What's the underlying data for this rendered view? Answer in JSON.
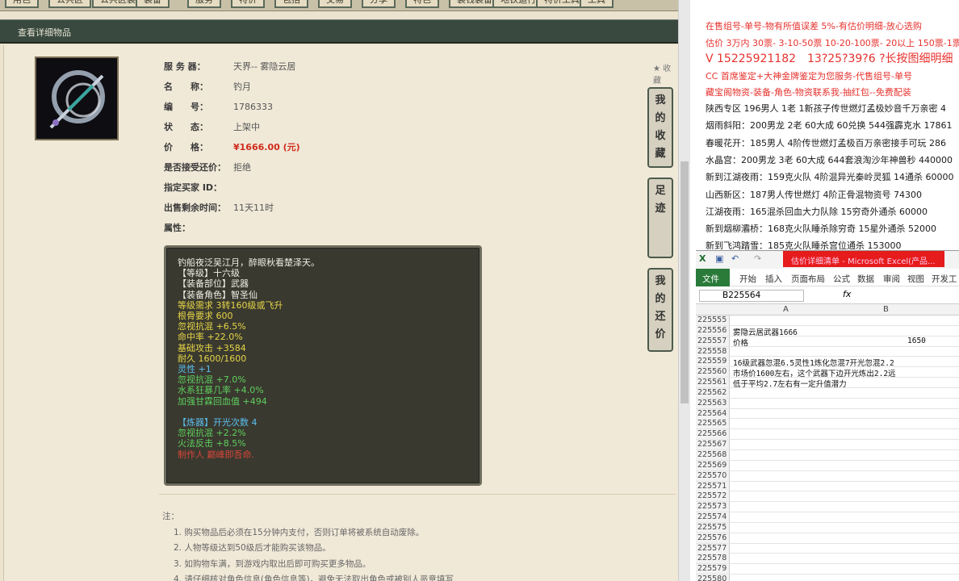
{
  "top_tabs": [
    "用色",
    "公共区",
    "公共区装备",
    "装备",
    "服务",
    "特价",
    "包括",
    "交易",
    "分享",
    "特色",
    "装钱装备",
    "地铁运行",
    "特价工具",
    "工具"
  ],
  "header": {
    "title": "查看详细物品"
  },
  "item": {
    "server_label": "服 务 器：",
    "server_value": "天界-- 雾隐云居",
    "name_label": "名　　称：",
    "name_value": "钓月",
    "id_label": "编　　号：",
    "id_value": "1786333",
    "status_label": "状　　态：",
    "status_value": "上架中",
    "price_label": "价　　格：",
    "price_value": "¥1666.00 (元)",
    "bargain_label": "是否接受还价：",
    "bargain_value": "拒绝",
    "buyer_label": "指定买家 ID：",
    "buyer_value": "",
    "remain_label": "出售剩余时间：",
    "remain_value": "11天11时",
    "attr_label": "属性："
  },
  "attributes": [
    {
      "text": "钓船夜泛吴江月，醉眼秋看楚泽天。",
      "color": "w"
    },
    {
      "text": "【等级】十六级",
      "color": "w"
    },
    {
      "text": "【装备部位】武器",
      "color": "w"
    },
    {
      "text": "【装备角色】智圣仙",
      "color": "w"
    },
    {
      "text": "等级需求 3转160级或飞升",
      "color": "y"
    },
    {
      "text": "根骨要求 600",
      "color": "y"
    },
    {
      "text": "忽视抗混 +6.5%",
      "color": "y"
    },
    {
      "text": "命中率 +22.0%",
      "color": "y"
    },
    {
      "text": "基础攻击 +3584",
      "color": "y"
    },
    {
      "text": "耐久 1600/1600",
      "color": "y"
    },
    {
      "text": "灵性 +1",
      "color": "c"
    },
    {
      "text": "忽视抗混 +7.0%",
      "color": "g"
    },
    {
      "text": "水系狂暴几率 +4.0%",
      "color": "g"
    },
    {
      "text": "加强甘霖回血值 +494",
      "color": "g"
    },
    {
      "text": "",
      "color": "w"
    },
    {
      "text": "【炼器】开光次数 4",
      "color": "c"
    },
    {
      "text": "忽视抗混 +2.2%",
      "color": "g"
    },
    {
      "text": "火法反击 +8.5%",
      "color": "g"
    },
    {
      "text": "制作人 巅峰即吾命.",
      "color": "r"
    }
  ],
  "side_buttons": [
    "我的收藏",
    "足迹",
    "我的还价"
  ],
  "collect_label": "收藏",
  "notes": {
    "title": "注：",
    "items": [
      "1. 购买物品后必须在15分钟内支付，否则订单将被系统自动废除。",
      "2. 人物等级达到50级后才能购买该物品。",
      "3. 如购物车满，到游戏内取出后即可购买更多物品。",
      "4. 请仔细核对角色信息(角色信息等)，避免无法取出角色或被别人恶意填写"
    ]
  },
  "ads": [
    {
      "text": "在售组号-单号-物有所值误差 5%-有估价明细-放心选购",
      "color": "red"
    },
    {
      "text": "估价 3万内 30票- 3-10-50票 10-20-100票- 20以上 150票-1票",
      "color": "red"
    },
    {
      "text": "V 15225921182　13?25?39?6 ?长按图细明细",
      "color": "red"
    },
    {
      "text": "CC 首席鉴定+大神金牌鉴定为您服务-代售组号-单号",
      "color": "red"
    },
    {
      "text": "藏宝阁物资-装备-角色-物资联系我-抽红包--免费配装",
      "color": "red"
    },
    {
      "text": "陕西专区 196男人 1老 1新孩子传世燃灯孟极妙音千万亲密 4",
      "color": "blk"
    },
    {
      "text": "烟雨斜阳：200男龙 2老 60大成 60兑换 544强霹克水 17861",
      "color": "blk"
    },
    {
      "text": "春暖花开：185男人 4阶传世燃灯孟极百万亲密接手可玩 286",
      "color": "blk"
    },
    {
      "text": "水晶宫：200男龙 3老 60大成 644套浪淘沙年神兽秒 440000",
      "color": "blk"
    },
    {
      "text": "新到江湖夜雨：159克火队 4阶混异光秦岭灵狐 14通杀 60000",
      "color": "blk"
    },
    {
      "text": "山西新区：187男人传世燃灯 4阶正骨混物资号 74300",
      "color": "blk"
    },
    {
      "text": "江湖夜雨：165混杀回血大力队除 15穷奇外通杀 60000",
      "color": "blk"
    },
    {
      "text": "新到烟柳灞桥：168克火队睡杀除穷奇 15星外通杀 52000",
      "color": "blk"
    },
    {
      "text": "新到飞鸿踏雪：185克火队睡杀宫位通杀 153000",
      "color": "blk"
    }
  ],
  "excel": {
    "title": "估价详细清单 - Microsoft Excel(产品...",
    "ribbon": [
      "文件",
      "开始",
      "插入",
      "页面布局",
      "公式",
      "数据",
      "审阅",
      "视图",
      "开发工"
    ],
    "cell_ref": "B225564",
    "fx": "fx",
    "col_a": "A",
    "col_b": "B",
    "rows": [
      {
        "n": "225555",
        "a": "",
        "b": ""
      },
      {
        "n": "225556",
        "a": "雾隐云居武器1666",
        "b": ""
      },
      {
        "n": "225557",
        "a": "价格",
        "b": "1650"
      },
      {
        "n": "225558",
        "a": "",
        "b": ""
      },
      {
        "n": "225559",
        "a": "16级武器忽混6.5灵性1炼化忽混7开光忽混2.2",
        "b": ""
      },
      {
        "n": "225560",
        "a": "市场价1600左右，这个武器下边开光炼出2.2远",
        "b": ""
      },
      {
        "n": "225561",
        "a": "低于平均2.7左右有一定升值潜力",
        "b": ""
      },
      {
        "n": "225562",
        "a": "",
        "b": ""
      },
      {
        "n": "225563",
        "a": "",
        "b": ""
      },
      {
        "n": "225564",
        "a": "",
        "b": ""
      },
      {
        "n": "225565",
        "a": "",
        "b": ""
      },
      {
        "n": "225566",
        "a": "",
        "b": ""
      },
      {
        "n": "225567",
        "a": "",
        "b": ""
      },
      {
        "n": "225568",
        "a": "",
        "b": ""
      },
      {
        "n": "225569",
        "a": "",
        "b": ""
      },
      {
        "n": "225570",
        "a": "",
        "b": ""
      },
      {
        "n": "225571",
        "a": "",
        "b": ""
      },
      {
        "n": "225572",
        "a": "",
        "b": ""
      },
      {
        "n": "225573",
        "a": "",
        "b": ""
      },
      {
        "n": "225574",
        "a": "",
        "b": ""
      },
      {
        "n": "225575",
        "a": "",
        "b": ""
      },
      {
        "n": "225576",
        "a": "",
        "b": ""
      },
      {
        "n": "225577",
        "a": "",
        "b": ""
      },
      {
        "n": "225578",
        "a": "",
        "b": ""
      },
      {
        "n": "225579",
        "a": "",
        "b": ""
      },
      {
        "n": "225580",
        "a": "",
        "b": ""
      }
    ]
  }
}
